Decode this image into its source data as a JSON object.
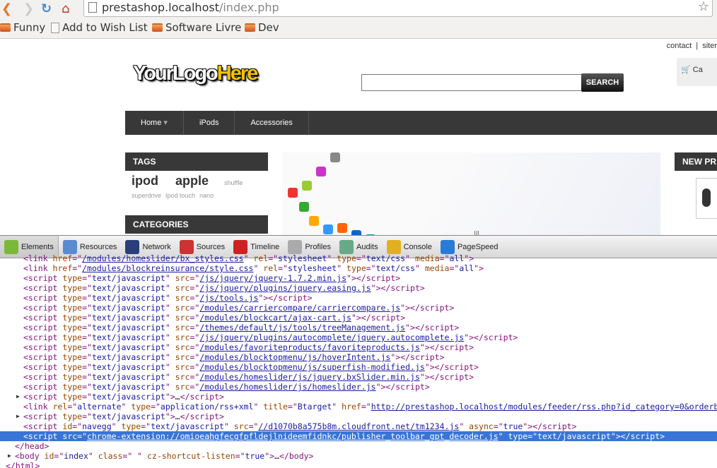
{
  "browser": {
    "url_host": "prestashop.localhost",
    "url_path": "/index.php",
    "bookmarks": [
      {
        "label": "Funny",
        "icon": "folder-icon"
      },
      {
        "label": "Add to Wish List",
        "icon": "page-icon"
      },
      {
        "label": "Software Livre",
        "icon": "folder-icon"
      },
      {
        "label": "Dev",
        "icon": "folder-icon"
      }
    ]
  },
  "page": {
    "top_links": {
      "contact": "contact",
      "sitemap": "siter"
    },
    "logo": {
      "part1": "YourLogo",
      "part2": "Here"
    },
    "search": {
      "value": "",
      "button": "SEARCH"
    },
    "cart_label": "Ca",
    "menu": [
      "Home",
      "iPods",
      "Accessories"
    ],
    "tags_title": "TAGS",
    "tags_big": [
      "ipod",
      "apple"
    ],
    "tags_small": [
      "shuffle",
      "superdrive",
      "Ipod touch",
      "nano"
    ],
    "categories_title": "CATEGORIES",
    "new_products_title": "NEW PR"
  },
  "devtools": {
    "tabs": [
      {
        "label": "Elements",
        "icon": "elements-icon",
        "color": "#7bb83a"
      },
      {
        "label": "Resources",
        "icon": "resources-icon",
        "color": "#5a8ad0"
      },
      {
        "label": "Network",
        "icon": "network-icon",
        "color": "#2a3f7a"
      },
      {
        "label": "Sources",
        "icon": "sources-icon",
        "color": "#c33"
      },
      {
        "label": "Timeline",
        "icon": "timeline-icon",
        "color": "#c22"
      },
      {
        "label": "Profiles",
        "icon": "profiles-icon",
        "color": "#aaa"
      },
      {
        "label": "Audits",
        "icon": "audits-icon",
        "color": "#6a8"
      },
      {
        "label": "Console",
        "icon": "console-icon",
        "color": "#e0b020"
      },
      {
        "label": "PageSpeed",
        "icon": "pagespeed-icon",
        "color": "#2a7ad8"
      }
    ],
    "active_tab": "Elements",
    "selected_line": 18,
    "lines": [
      {
        "i": 33,
        "seg": [
          [
            "tag",
            "<link "
          ],
          [
            "attr",
            "href"
          ],
          [
            "tag",
            "=\""
          ],
          [
            "link",
            "/modules/homeslider/bx_styles.css"
          ],
          [
            "tag",
            "\" "
          ],
          [
            "attr",
            "rel"
          ],
          [
            "tag",
            "=\""
          ],
          [
            "val",
            "stylesheet"
          ],
          [
            "tag",
            "\" "
          ],
          [
            "attr",
            "type"
          ],
          [
            "tag",
            "=\""
          ],
          [
            "val",
            "text/css"
          ],
          [
            "tag",
            "\" "
          ],
          [
            "attr",
            "media"
          ],
          [
            "tag",
            "=\""
          ],
          [
            "val",
            "all"
          ],
          [
            "tag",
            "\">"
          ]
        ]
      },
      {
        "i": 33,
        "seg": [
          [
            "tag",
            "<link "
          ],
          [
            "attr",
            "href"
          ],
          [
            "tag",
            "=\""
          ],
          [
            "link",
            "/modules/blockreinsurance/style.css"
          ],
          [
            "tag",
            "\" "
          ],
          [
            "attr",
            "rel"
          ],
          [
            "tag",
            "=\""
          ],
          [
            "val",
            "stylesheet"
          ],
          [
            "tag",
            "\" "
          ],
          [
            "attr",
            "type"
          ],
          [
            "tag",
            "=\""
          ],
          [
            "val",
            "text/css"
          ],
          [
            "tag",
            "\" "
          ],
          [
            "attr",
            "media"
          ],
          [
            "tag",
            "=\""
          ],
          [
            "val",
            "all"
          ],
          [
            "tag",
            "\">"
          ]
        ]
      },
      {
        "i": 33,
        "src": "/js/jquery/jquery-1.7.2.min.js"
      },
      {
        "i": 33,
        "src": "/js/jquery/plugins/jquery.easing.js"
      },
      {
        "i": 33,
        "src": "/js/tools.js"
      },
      {
        "i": 33,
        "src": "/modules/carriercompare/carriercompare.js"
      },
      {
        "i": 33,
        "src": "/modules/blockcart/ajax-cart.js"
      },
      {
        "i": 33,
        "src": "/themes/default/js/tools/treeManagement.js"
      },
      {
        "i": 33,
        "src": "/js/jquery/plugins/autocomplete/jquery.autocomplete.js"
      },
      {
        "i": 33,
        "src": "/modules/favoriteproducts/favoriteproducts.js"
      },
      {
        "i": 33,
        "src": "/modules/blocktopmenu/js/hoverIntent.js"
      },
      {
        "i": 33,
        "src": "/modules/blocktopmenu/js/superfish-modified.js"
      },
      {
        "i": 33,
        "src": "/modules/homeslider/js/jquery.bxSlider.min.js"
      },
      {
        "i": 33,
        "src": "/modules/homeslider/js/homeslider.js"
      },
      {
        "i": 33,
        "tri": true,
        "seg": [
          [
            "tag",
            "<script "
          ],
          [
            "attr",
            "type"
          ],
          [
            "tag",
            "=\""
          ],
          [
            "val",
            "text/javascript"
          ],
          [
            "tag",
            "\">"
          ],
          [
            "plain",
            "…"
          ],
          [
            "tag",
            "</script>"
          ]
        ]
      },
      {
        "i": 33,
        "seg": [
          [
            "tag",
            "<link "
          ],
          [
            "attr",
            "rel"
          ],
          [
            "tag",
            "=\""
          ],
          [
            "val",
            "alternate"
          ],
          [
            "tag",
            "\" "
          ],
          [
            "attr",
            "type"
          ],
          [
            "tag",
            "=\""
          ],
          [
            "val",
            "application/rss+xml"
          ],
          [
            "tag",
            "\" "
          ],
          [
            "attr",
            "title"
          ],
          [
            "tag",
            "=\""
          ],
          [
            "val",
            "Btarget"
          ],
          [
            "tag",
            "\" "
          ],
          [
            "attr",
            "href"
          ],
          [
            "tag",
            "=\""
          ],
          [
            "link",
            "http://prestashop.localhost/modules/feeder/rss.php?id_category=0&orderby=position&orderway=ASC"
          ]
        ]
      },
      {
        "i": 33,
        "tri": true,
        "seg": [
          [
            "tag",
            "<script "
          ],
          [
            "attr",
            "type"
          ],
          [
            "tag",
            "=\""
          ],
          [
            "val",
            "text/javascript"
          ],
          [
            "tag",
            "\">"
          ],
          [
            "plain",
            "…"
          ],
          [
            "tag",
            "</script>"
          ]
        ]
      },
      {
        "i": 33,
        "seg": [
          [
            "tag",
            "<script "
          ],
          [
            "attr",
            "id"
          ],
          [
            "tag",
            "=\""
          ],
          [
            "val",
            "navegg"
          ],
          [
            "tag",
            "\" "
          ],
          [
            "attr",
            "type"
          ],
          [
            "tag",
            "=\""
          ],
          [
            "val",
            "text/javascript"
          ],
          [
            "tag",
            "\" "
          ],
          [
            "attr",
            "src"
          ],
          [
            "tag",
            "=\""
          ],
          [
            "link",
            "//d1070b8a575b8m.cloudfront.net/tm1234.js"
          ],
          [
            "tag",
            "\" "
          ],
          [
            "attr",
            "async"
          ],
          [
            "tag",
            "=\""
          ],
          [
            "val",
            "true"
          ],
          [
            "tag",
            "\"></script>"
          ]
        ]
      },
      {
        "i": 33,
        "seg": [
          [
            "tag",
            "<script "
          ],
          [
            "attr",
            "src"
          ],
          [
            "tag",
            "=\""
          ],
          [
            "link",
            "chrome-extension://omioeahgfecgfpfldejlnideemfidnkc/publisher_toolbar_gpt_decoder.js"
          ],
          [
            "tag",
            "\" "
          ],
          [
            "attr",
            "type"
          ],
          [
            "tag",
            "=\""
          ],
          [
            "val",
            "text/javascript"
          ],
          [
            "tag",
            "\"></script>"
          ]
        ]
      },
      {
        "i": 21,
        "seg": [
          [
            "tag",
            "</head>"
          ]
        ]
      },
      {
        "i": 21,
        "tri": true,
        "seg": [
          [
            "tag",
            "<body "
          ],
          [
            "attr",
            "id"
          ],
          [
            "tag",
            "=\""
          ],
          [
            "val",
            "index"
          ],
          [
            "tag",
            "\" "
          ],
          [
            "attr",
            "class"
          ],
          [
            "tag",
            "=\""
          ],
          [
            "val",
            " "
          ],
          [
            "tag",
            "\" "
          ],
          [
            "attr",
            "cz-shortcut-listen"
          ],
          [
            "tag",
            "=\""
          ],
          [
            "val",
            "true"
          ],
          [
            "tag",
            "\">"
          ],
          [
            "plain",
            "…"
          ],
          [
            "tag",
            "</body>"
          ]
        ]
      },
      {
        "i": 8,
        "seg": [
          [
            "tag",
            "</html>"
          ]
        ]
      }
    ]
  }
}
